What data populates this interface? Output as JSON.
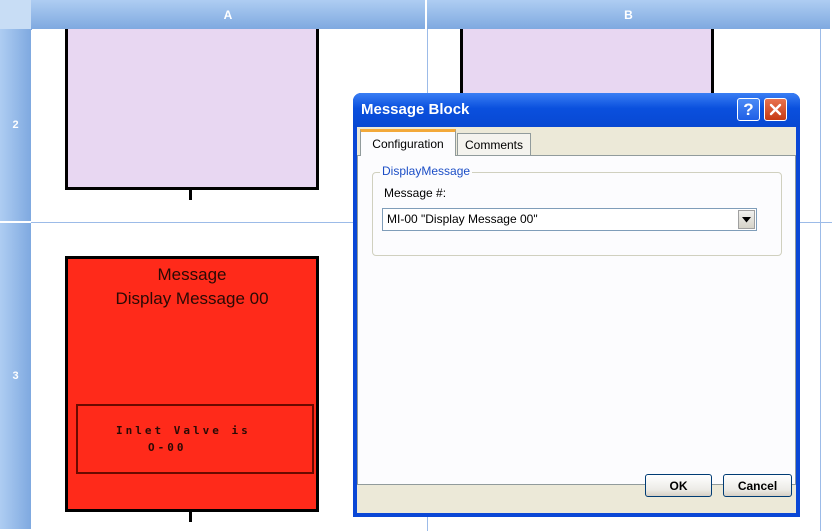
{
  "spreadsheet": {
    "columns": [
      "A",
      "B"
    ],
    "rows": [
      "2",
      "3"
    ]
  },
  "blocks": {
    "message_block": {
      "title_line1": "Message",
      "title_line2": "Display Message 00",
      "inner_line1": "Inlet Valve is",
      "inner_line2": "O-00",
      "color": "#ff2a1a"
    },
    "pink_color": "#e8d7f2"
  },
  "dialog": {
    "title": "Message Block",
    "help_label": "?",
    "close_label": "X",
    "tabs": [
      {
        "label": "Configuration",
        "active": true
      },
      {
        "label": "Comments",
        "active": false
      }
    ],
    "group_label": "DisplayMessage",
    "field_label": "Message #:",
    "message_value": "MI-00 \"Display Message 00\"",
    "ok_label": "OK",
    "cancel_label": "Cancel"
  }
}
